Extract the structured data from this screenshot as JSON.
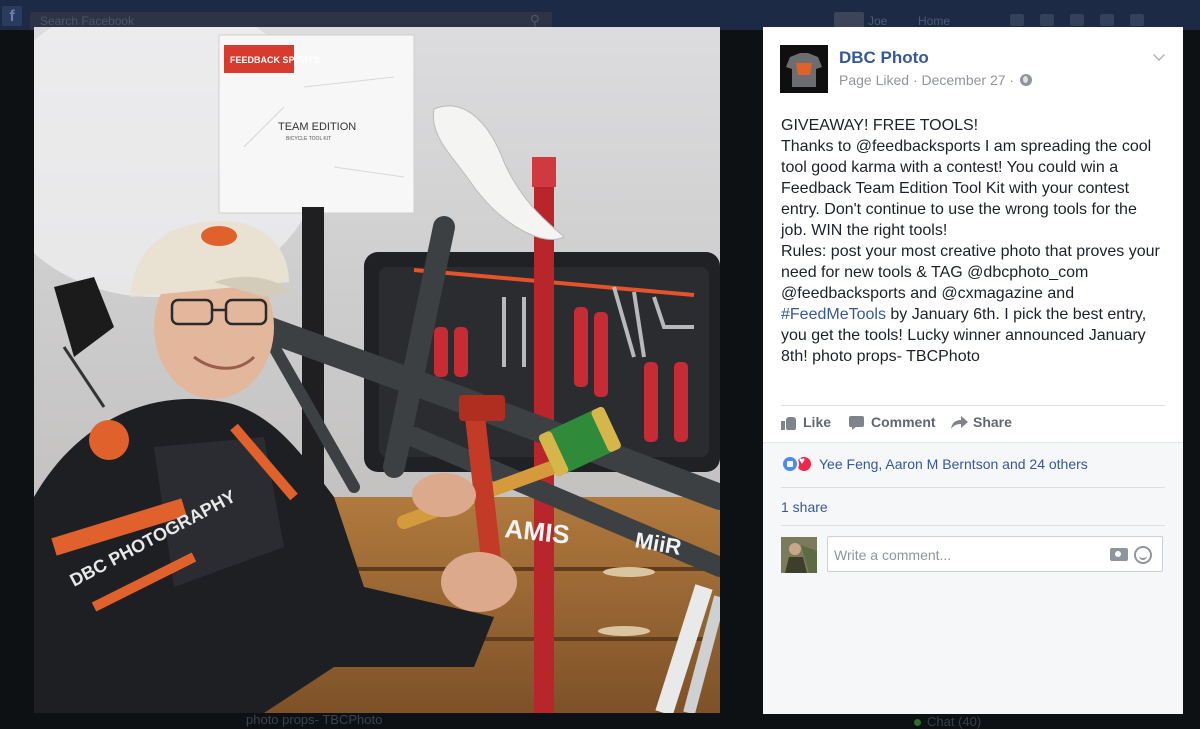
{
  "background": {
    "search_placeholder": "Search Facebook",
    "user_name": "Joe",
    "home_label": "Home",
    "caption_remnant": "photo props- TBCPhoto",
    "chat_label": "Chat (40)"
  },
  "photo": {
    "alt": "Man in DBC Photography cycling jersey holding a pipe wrench and mallet in front of a bicycle and a Feedback Sports Team Edition tool kit",
    "box_label_brand": "FEEDBACK SPORTS",
    "box_label_title": "TEAM EDITION",
    "box_label_sub": "BICYCLE TOOL KIT",
    "frame_text": "AMIS",
    "frame_text2": "MiiR",
    "jersey_text": "DBC PHOTOGRAPHY"
  },
  "post": {
    "page_name": "DBC Photo",
    "meta": "Page Liked · December 27 · ",
    "body_before_hashtag": "GIVEAWAY! FREE TOOLS!\nThanks to @feedbacksports I am spreading the cool tool good karma with a contest! You could win a Feedback Team Edition Tool Kit with your contest entry. Don't continue to use the wrong tools for the job. WIN the right tools!\nRules: post your most creative photo that proves your need for new tools & TAG @dbcphoto_com @feedbacksports and @cxmagazine and\n",
    "hashtag": "#FeedMeTools",
    "body_after_hashtag": " by January 6th. I pick the best entry, you get the tools! Lucky winner announced January 8th! photo props- TBCPhoto"
  },
  "actions": {
    "like": "Like",
    "comment": "Comment",
    "share": "Share"
  },
  "reactions": {
    "summary": "Yee Feng, Aaron M Berntson and 24 others"
  },
  "shares": {
    "text": "1 share"
  },
  "comment_input": {
    "placeholder": "Write a comment..."
  },
  "colors": {
    "link_blue": "#365899",
    "facebook_navy": "#1d2a45",
    "like_blue": "#4c8bf5",
    "love_red": "#f0284a"
  }
}
